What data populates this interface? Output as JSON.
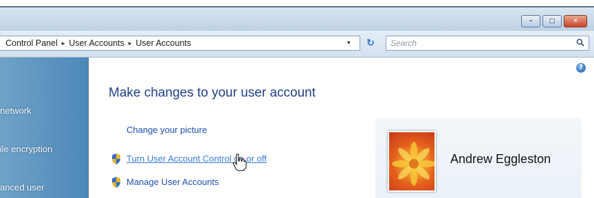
{
  "window": {
    "minimize_glyph": "–",
    "maximize_glyph": "□",
    "close_glyph": "✕"
  },
  "address_bar": {
    "breadcrumbs": [
      "Control Panel",
      "User Accounts",
      "User Accounts"
    ],
    "separator": "▸",
    "dropdown_glyph": "▾",
    "refresh_glyph": "↻",
    "search_placeholder": "Search"
  },
  "side_pane": {
    "items": [
      "network",
      "file encryption",
      "anced user"
    ]
  },
  "main": {
    "help_glyph": "?",
    "title": "Make changes to your user account",
    "links": {
      "change_picture": "Change your picture",
      "turn_uac": "Turn User Account Control on or off",
      "manage_accounts": "Manage User Accounts"
    }
  },
  "user": {
    "name": "Andrew Eggleston"
  },
  "colors": {
    "link": "#1e4fb3",
    "title": "#1e3f87",
    "side_pane": "#5a93c1"
  },
  "icons": [
    "shield-icon",
    "help-icon",
    "refresh-icon",
    "search-icon",
    "hand-cursor-icon"
  ]
}
